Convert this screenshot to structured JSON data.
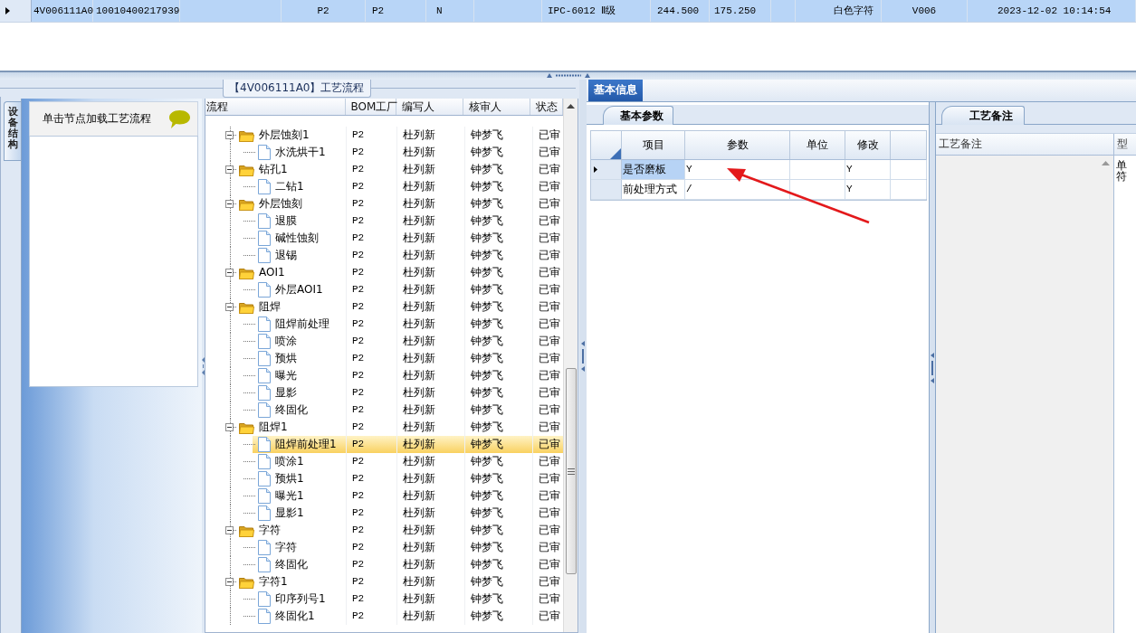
{
  "top_grid": {
    "rows": [
      {
        "selected": true,
        "cells": {
          "column_1": "4V006111A0",
          "column_2": "10010400217939",
          "column_4": "P2",
          "column_5": "P2",
          "column_6": "N",
          "column_8": "IPC-6012 Ⅱ级",
          "column_9": "244.500",
          "column_10": "175.250",
          "column_12": "白色字符",
          "column_13": "V006",
          "column_14": "2023-12-02 10:14:54"
        }
      }
    ]
  },
  "process_panel": {
    "title": "【4V006111A0】工艺流程",
    "side_tab": {
      "label": "设备结构",
      "selected": true
    },
    "node_hint": "单击节点加载工艺流程",
    "tree": {
      "columns": [
        "流程",
        "BOM工厂",
        "编写人",
        "核审人",
        "状态"
      ],
      "rows": [
        {
          "kind": "folder",
          "label": "外层蚀刻1",
          "factory": "P2",
          "author": "杜列新",
          "reviewer": "钟梦飞",
          "status": "已审",
          "selected": false,
          "expanded": true,
          "children": [
            {
              "kind": "doc",
              "label": "水洗烘干1",
              "factory": "P2",
              "author": "杜列新",
              "reviewer": "钟梦飞",
              "status": "已审",
              "selected": false
            }
          ]
        },
        {
          "kind": "folder",
          "label": "钻孔1",
          "factory": "P2",
          "author": "杜列新",
          "reviewer": "钟梦飞",
          "status": "已审",
          "selected": false,
          "expanded": true,
          "children": [
            {
              "kind": "doc",
              "label": "二钻1",
              "factory": "P2",
              "author": "杜列新",
              "reviewer": "钟梦飞",
              "status": "已审",
              "selected": false
            }
          ]
        },
        {
          "kind": "folder",
          "label": "外层蚀刻",
          "factory": "P2",
          "author": "杜列新",
          "reviewer": "钟梦飞",
          "status": "已审",
          "selected": false,
          "expanded": true,
          "children": [
            {
              "kind": "doc",
              "label": "退膜",
              "factory": "P2",
              "author": "杜列新",
              "reviewer": "钟梦飞",
              "status": "已审",
              "selected": false
            },
            {
              "kind": "doc",
              "label": "碱性蚀刻",
              "factory": "P2",
              "author": "杜列新",
              "reviewer": "钟梦飞",
              "status": "已审",
              "selected": false
            },
            {
              "kind": "doc",
              "label": "退锡",
              "factory": "P2",
              "author": "杜列新",
              "reviewer": "钟梦飞",
              "status": "已审",
              "selected": false
            }
          ]
        },
        {
          "kind": "folder",
          "label": "AOI1",
          "factory": "P2",
          "author": "杜列新",
          "reviewer": "钟梦飞",
          "status": "已审",
          "selected": false,
          "expanded": true,
          "children": [
            {
              "kind": "doc",
              "label": "外层AOI1",
              "factory": "P2",
              "author": "杜列新",
              "reviewer": "钟梦飞",
              "status": "已审",
              "selected": false
            }
          ]
        },
        {
          "kind": "folder",
          "label": "阻焊",
          "factory": "P2",
          "author": "杜列新",
          "reviewer": "钟梦飞",
          "status": "已审",
          "selected": false,
          "expanded": true,
          "children": [
            {
              "kind": "doc",
              "label": "阻焊前处理",
              "factory": "P2",
              "author": "杜列新",
              "reviewer": "钟梦飞",
              "status": "已审",
              "selected": false
            },
            {
              "kind": "doc",
              "label": "喷涂",
              "factory": "P2",
              "author": "杜列新",
              "reviewer": "钟梦飞",
              "status": "已审",
              "selected": false
            },
            {
              "kind": "doc",
              "label": "预烘",
              "factory": "P2",
              "author": "杜列新",
              "reviewer": "钟梦飞",
              "status": "已审",
              "selected": false
            },
            {
              "kind": "doc",
              "label": "曝光",
              "factory": "P2",
              "author": "杜列新",
              "reviewer": "钟梦飞",
              "status": "已审",
              "selected": false
            },
            {
              "kind": "doc",
              "label": "显影",
              "factory": "P2",
              "author": "杜列新",
              "reviewer": "钟梦飞",
              "status": "已审",
              "selected": false
            },
            {
              "kind": "doc",
              "label": "终固化",
              "factory": "P2",
              "author": "杜列新",
              "reviewer": "钟梦飞",
              "status": "已审",
              "selected": false
            }
          ]
        },
        {
          "kind": "folder",
          "label": "阻焊1",
          "factory": "P2",
          "author": "杜列新",
          "reviewer": "钟梦飞",
          "status": "已审",
          "selected": false,
          "expanded": true,
          "children": [
            {
              "kind": "doc",
              "label": "阻焊前处理1",
              "factory": "P2",
              "author": "杜列新",
              "reviewer": "钟梦飞",
              "status": "已审",
              "selected": true
            },
            {
              "kind": "doc",
              "label": "喷涂1",
              "factory": "P2",
              "author": "杜列新",
              "reviewer": "钟梦飞",
              "status": "已审",
              "selected": false
            },
            {
              "kind": "doc",
              "label": "预烘1",
              "factory": "P2",
              "author": "杜列新",
              "reviewer": "钟梦飞",
              "status": "已审",
              "selected": false
            },
            {
              "kind": "doc",
              "label": "曝光1",
              "factory": "P2",
              "author": "杜列新",
              "reviewer": "钟梦飞",
              "status": "已审",
              "selected": false
            },
            {
              "kind": "doc",
              "label": "显影1",
              "factory": "P2",
              "author": "杜列新",
              "reviewer": "钟梦飞",
              "status": "已审",
              "selected": false
            }
          ]
        },
        {
          "kind": "folder",
          "label": "字符",
          "factory": "P2",
          "author": "杜列新",
          "reviewer": "钟梦飞",
          "status": "已审",
          "selected": false,
          "expanded": true,
          "children": [
            {
              "kind": "doc",
              "label": "字符",
              "factory": "P2",
              "author": "杜列新",
              "reviewer": "钟梦飞",
              "status": "已审",
              "selected": false
            },
            {
              "kind": "doc",
              "label": "终固化",
              "factory": "P2",
              "author": "杜列新",
              "reviewer": "钟梦飞",
              "status": "已审",
              "selected": false
            }
          ]
        },
        {
          "kind": "folder",
          "label": "字符1",
          "factory": "P2",
          "author": "杜列新",
          "reviewer": "钟梦飞",
          "status": "已审",
          "selected": false,
          "expanded": true,
          "children": [
            {
              "kind": "doc",
              "label": "印序列号1",
              "factory": "P2",
              "author": "杜列新",
              "reviewer": "钟梦飞",
              "status": "已审",
              "selected": false
            },
            {
              "kind": "doc",
              "label": "终固化1",
              "factory": "P2",
              "author": "杜列新",
              "reviewer": "钟梦飞",
              "status": "已审",
              "selected": false
            }
          ]
        }
      ]
    }
  },
  "info_tabs": [
    {
      "label": "基本信息",
      "selected": true
    }
  ],
  "params_panel": {
    "tabs": [
      {
        "label": "基本参数",
        "selected": true
      }
    ],
    "columns": [
      "项目",
      "参数",
      "单位",
      "修改"
    ],
    "rows": [
      {
        "item": "是否磨板",
        "value": "Y",
        "modify": "Y",
        "selected": true
      },
      {
        "item": "前处理方式",
        "value": "/",
        "modify": "Y",
        "selected": false
      }
    ],
    "annotation": {
      "kind": "arrow"
    }
  },
  "notes_panel": {
    "tabs": [
      {
        "label": "工艺备注",
        "selected": true
      }
    ],
    "columns": [
      "工艺备注",
      "型"
    ],
    "model_lines": [
      "单",
      "符"
    ]
  }
}
